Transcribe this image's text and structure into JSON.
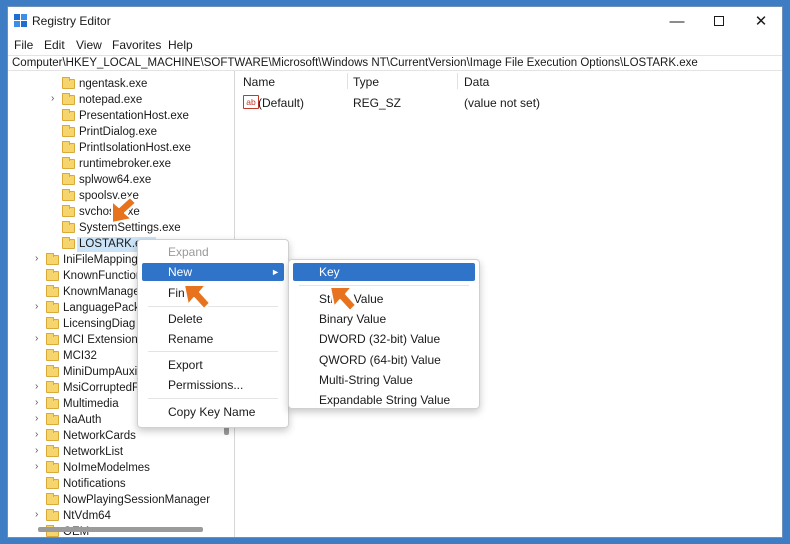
{
  "window": {
    "title": "Registry Editor"
  },
  "menubar": [
    "File",
    "Edit",
    "View",
    "Favorites",
    "Help"
  ],
  "address": "Computer\\HKEY_LOCAL_MACHINE\\SOFTWARE\\Microsoft\\Windows NT\\CurrentVersion\\Image File Execution Options\\LOSTARK.exe",
  "tree": {
    "children": [
      {
        "label": "ngentask.exe"
      },
      {
        "label": "notepad.exe"
      },
      {
        "label": "PresentationHost.exe"
      },
      {
        "label": "PrintDialog.exe"
      },
      {
        "label": "PrintIsolationHost.exe"
      },
      {
        "label": "runtimebroker.exe"
      },
      {
        "label": "splwow64.exe"
      },
      {
        "label": "spoolsv.exe"
      },
      {
        "label": "svchost.exe"
      },
      {
        "label": "SystemSettings.exe"
      },
      {
        "label": "LOSTARK.exe"
      }
    ],
    "siblings": [
      {
        "label": "IniFileMapping"
      },
      {
        "label": "KnownFunctionTableDlls"
      },
      {
        "label": "KnownManagedDebuggingDlls"
      },
      {
        "label": "LanguagePack"
      },
      {
        "label": "LicensingDiag"
      },
      {
        "label": "MCI Extensions"
      },
      {
        "label": "MCI32"
      },
      {
        "label": "MiniDumpAuxiliaryDlls"
      },
      {
        "label": "MsiCorruptedFileRecovery"
      },
      {
        "label": "Multimedia"
      },
      {
        "label": "NaAuth"
      },
      {
        "label": "NetworkCards"
      },
      {
        "label": "NetworkList"
      },
      {
        "label": "NoImeModelmes"
      },
      {
        "label": "Notifications"
      },
      {
        "label": "NowPlayingSessionManager"
      },
      {
        "label": "NtVdm64"
      },
      {
        "label": "OEM"
      }
    ]
  },
  "values": {
    "headers": {
      "name": "Name",
      "type": "Type",
      "data": "Data"
    },
    "rows": [
      {
        "name": "(Default)",
        "type": "REG_SZ",
        "data": "(value not set)",
        "icon": "string-value-icon"
      }
    ]
  },
  "context_menu": {
    "expand": "Expand",
    "new": "New",
    "find": "Find...",
    "delete": "Delete",
    "rename": "Rename",
    "export": "Export",
    "permissions": "Permissions...",
    "copy_key_name": "Copy Key Name"
  },
  "new_submenu": [
    "Key",
    "String Value",
    "Binary Value",
    "DWORD (32-bit) Value",
    "QWORD (64-bit) Value",
    "Multi-String Value",
    "Expandable String Value"
  ],
  "colors": {
    "accent": "#2f74c9",
    "selection": "#cce4f7",
    "pointer": "#e8731e",
    "background": "#3e7cc4"
  }
}
